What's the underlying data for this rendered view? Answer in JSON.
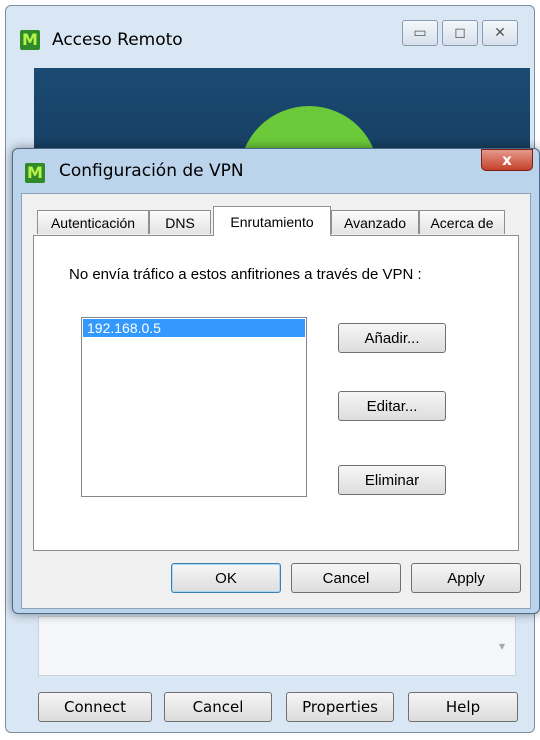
{
  "background_window": {
    "title": "Acceso Remoto",
    "caption_buttons": [
      {
        "name": "minimize-icon",
        "glyph": "▭"
      },
      {
        "name": "maximize-icon",
        "glyph": "◻"
      },
      {
        "name": "close-icon",
        "glyph": "✕"
      }
    ],
    "buttons": {
      "connect": "Connect",
      "cancel": "Cancel",
      "properties": "Properties",
      "help": "Help"
    },
    "scroll_arrow": "▾"
  },
  "vpn_dialog": {
    "title": "Configuración de VPN",
    "close_glyph": "x",
    "tabs": [
      {
        "label": "Autenticación",
        "active": false
      },
      {
        "label": "DNS",
        "active": false
      },
      {
        "label": "Enrutamiento",
        "active": true
      },
      {
        "label": "Avanzado",
        "active": false
      },
      {
        "label": "Acerca de",
        "active": false
      }
    ],
    "routing": {
      "description": "No envía tráfico a estos anfitriones a través de VPN :",
      "hosts": [
        "192.168.0.5"
      ],
      "add_label": "Añadir...",
      "edit_label": "Editar...",
      "remove_label": "Eliminar"
    },
    "buttons": {
      "ok": "OK",
      "cancel": "Cancel",
      "apply": "Apply"
    }
  },
  "brand": {
    "logo_letter": "M",
    "logo_green": "#2f8a2a",
    "banner_blue": "#1b4a72",
    "selection_blue": "#3399ff"
  }
}
